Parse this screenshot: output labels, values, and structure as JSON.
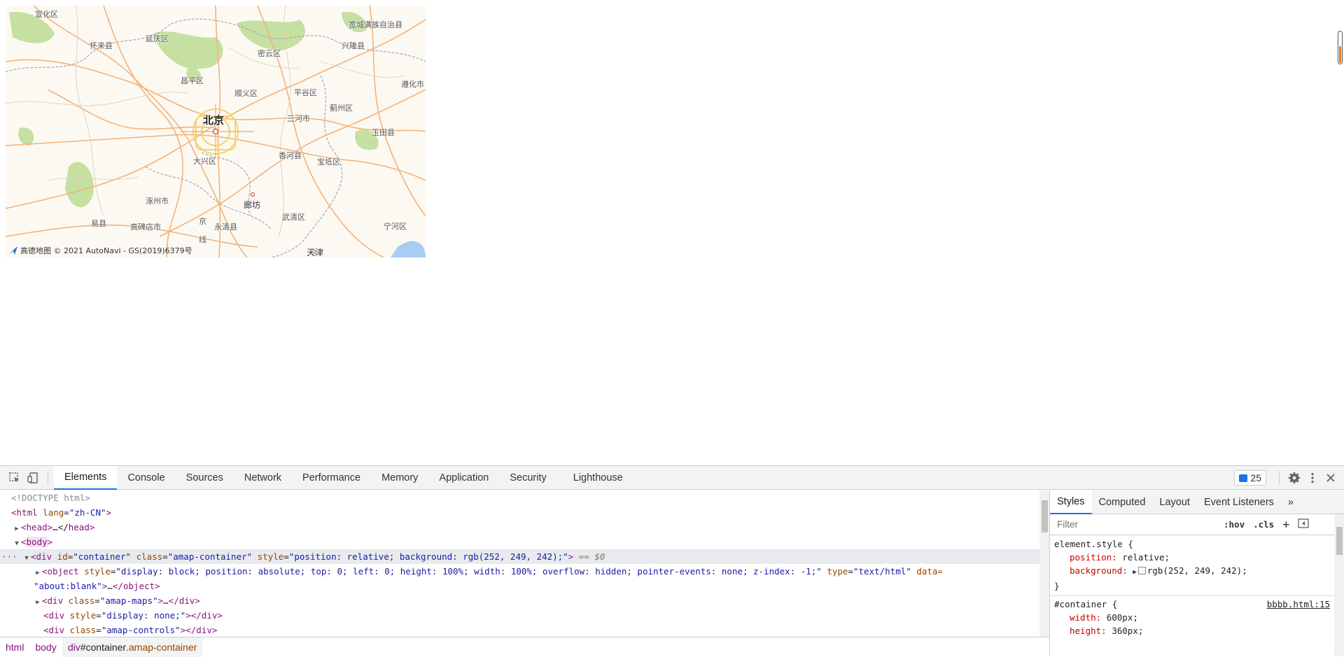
{
  "map": {
    "labels": {
      "xuanhua": "宣化区",
      "huailai": "怀来县",
      "yanqing": "延庆区",
      "miyun": "密云区",
      "kuancheng": "宽城满族自治县",
      "xinglong": "兴隆县",
      "changping": "昌平区",
      "shunyi": "顺义区",
      "pinggu": "平谷区",
      "zunhua": "遵化市",
      "beijing": "北京",
      "sanhe": "三河市",
      "jizhou": "蓟州区",
      "yutian": "玉田县",
      "daxing": "大兴区",
      "xianghe": "香河县",
      "baodi": "宝坻区",
      "zhuozhou": "涿州市",
      "langfang": "廊坊",
      "yixian": "易县",
      "gaobeidian": "高碑店市",
      "yongqing": "永清县",
      "wuqing": "武清区",
      "ninghe": "宁河区",
      "tianjin": "天津",
      "jing": "京",
      "xian": "线"
    },
    "copyright": "高德地图 © 2021 AutoNavi - GS(2019)6379号",
    "colors": {
      "background": "#fcf9f2",
      "road": "#f3b27a",
      "green": "#b9d98c",
      "ring": "#f5d36b"
    }
  },
  "devtools": {
    "tabs": [
      "Elements",
      "Console",
      "Sources",
      "Network",
      "Performance",
      "Memory",
      "Application",
      "Security",
      "Lighthouse"
    ],
    "active_tab": "Elements",
    "issues_count": "25",
    "dom": {
      "doctype": "<!DOCTYPE html>",
      "html_open": "html",
      "html_attr": "lang",
      "html_val": "\"zh-CN\"",
      "head": "head",
      "head_ellipsis": "…</",
      "body": "body",
      "container_tag": "div",
      "container_id_attr": "id",
      "container_id_val": "\"container\"",
      "container_class_attr": "class",
      "container_class_val": "\"amap-container\"",
      "container_style_attr": "style",
      "container_style_val": "\"position: relative; background: rgb(252, 249, 242);\"",
      "dollar0": "== $0",
      "object_tag": "object",
      "object_style_attr": "style",
      "object_style_val": "\"display: block; position: absolute; top: 0; left: 0; height: 100%; width: 100%; overflow: hidden; pointer-events: none; z-index: -1;\"",
      "object_type_attr": "type",
      "object_type_val": "\"text/html\"",
      "object_data_attr": "data=",
      "object_data_val": "\"about:blank\"",
      "maps_class_val": "\"amap-maps\"",
      "none_style_val": "\"display: none;\"",
      "controls_class_val": "\"amap-controls\""
    },
    "breadcrumbs": {
      "html": "html",
      "body": "body",
      "div_tag": "div",
      "div_id": "#container",
      "div_class": ".amap-container"
    },
    "styles": {
      "tabs": [
        "Styles",
        "Computed",
        "Layout",
        "Event Listeners"
      ],
      "more": "»",
      "filter_placeholder": "Filter",
      "hov": ":hov",
      "cls": ".cls",
      "element_style_selector": "element.style {",
      "prop_position": "position",
      "val_position": "relative;",
      "prop_background": "background",
      "val_background": "rgb(252, 249, 242);",
      "close_brace": "}",
      "container_selector": "#container {",
      "container_source": "bbbb.html:15",
      "prop_width": "width",
      "val_width": "600px;",
      "prop_height": "height",
      "val_height": "360px;"
    }
  }
}
